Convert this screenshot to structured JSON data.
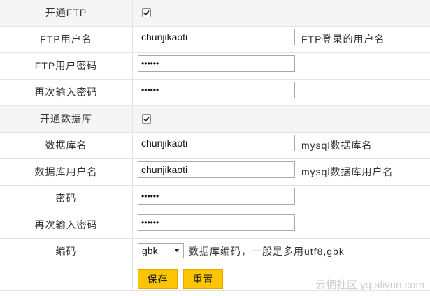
{
  "form": {
    "ftp_enable": {
      "label": "开通FTP",
      "checked": true
    },
    "ftp_username": {
      "label": "FTP用户名",
      "value": "chunjikaoti",
      "hint": "FTP登录的用户名"
    },
    "ftp_password": {
      "label": "FTP用户密码",
      "value": "abcdef"
    },
    "ftp_password_confirm": {
      "label": "再次输入密码",
      "value": "abcdef"
    },
    "db_enable": {
      "label": "开通数据库",
      "checked": true
    },
    "db_name": {
      "label": "数据库名",
      "value": "chunjikaoti",
      "hint": "mysql数据库名"
    },
    "db_username": {
      "label": "数据库用户名",
      "value": "chunjikaoti",
      "hint": "mysql数据库用户名"
    },
    "db_password": {
      "label": "密码",
      "value": "abcdef"
    },
    "db_password_confirm": {
      "label": "再次输入密码",
      "value": "abcdef"
    },
    "encoding": {
      "label": "编码",
      "selected": "gbk",
      "hint": "数据库编码，一般是多用utf8,gbk"
    }
  },
  "buttons": {
    "save": "保存",
    "reset": "重置"
  },
  "watermark": "云栖社区 yq.aliyun.com",
  "colors": {
    "button_bg": "#ffc400",
    "row_shade": "#f5f5f5",
    "border": "#e4e4e4"
  }
}
